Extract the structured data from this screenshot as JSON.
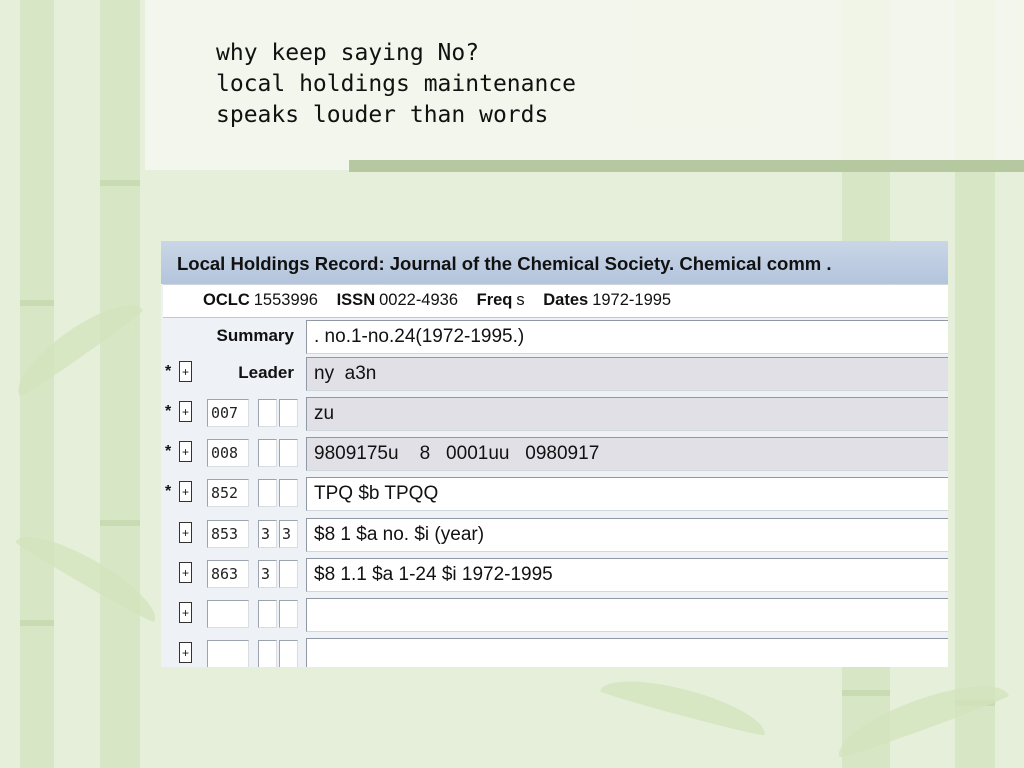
{
  "slide": {
    "title_lines": [
      "why keep saying No?",
      "local holdings maintenance",
      "speaks louder than words"
    ]
  },
  "record": {
    "header_title": "Local Holdings Record: Journal of the Chemical Society. Chemical comm .",
    "meta": {
      "oclc_label": "OCLC",
      "oclc_value": "1553996",
      "issn_label": "ISSN",
      "issn_value": "0022-4936",
      "freq_label": "Freq",
      "freq_value": "s",
      "dates_label": "Dates",
      "dates_value": "1972-1995"
    },
    "summary": {
      "label": "Summary",
      "value": ". no.1-no.24(1972-1995.)"
    },
    "leader": {
      "label": "Leader",
      "value": "ny  a3n"
    },
    "fields": [
      {
        "tag": "007",
        "ind1": "",
        "ind2": "",
        "value": "zu"
      },
      {
        "tag": "008",
        "ind1": "",
        "ind2": "",
        "value": "9809175u    8   0001uu   0980917"
      },
      {
        "tag": "852",
        "ind1": "",
        "ind2": "",
        "value": "TPQ $b TPQQ"
      },
      {
        "tag": "853",
        "ind1": "3",
        "ind2": "3",
        "value": "$8 1 $a no. $i (year)"
      },
      {
        "tag": "863",
        "ind1": "3",
        "ind2": "",
        "value": "$8 1.1 $a 1-24 $i 1972-1995"
      },
      {
        "tag": "",
        "ind1": "",
        "ind2": "",
        "value": ""
      },
      {
        "tag": "",
        "ind1": "",
        "ind2": "",
        "value": ""
      }
    ],
    "star_glyph": "*",
    "plus_glyph": "+"
  },
  "colors": {
    "background": "#e6efd9",
    "header": "#b3c4dc",
    "accent_bar": "#b6c8a0"
  }
}
